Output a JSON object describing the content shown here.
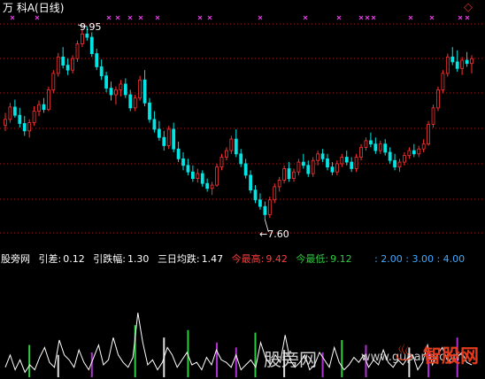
{
  "header": {
    "symbol": "万 科A(日线)",
    "nav_icon": "diamond-icon"
  },
  "chart_data": {
    "type": "candlestick",
    "title": "",
    "high_annotation": "9.95",
    "low_annotation": "←7.60",
    "price_high": 9.95,
    "price_low": 7.6,
    "ohlc": [
      [
        8.75,
        8.9,
        8.68,
        8.82
      ],
      [
        8.82,
        9.02,
        8.78,
        8.97
      ],
      [
        8.97,
        9.06,
        8.84,
        8.87
      ],
      [
        8.87,
        8.96,
        8.72,
        8.77
      ],
      [
        8.77,
        8.86,
        8.62,
        8.68
      ],
      [
        8.68,
        8.82,
        8.6,
        8.78
      ],
      [
        8.78,
        8.98,
        8.74,
        8.92
      ],
      [
        8.92,
        9.05,
        8.86,
        9.0
      ],
      [
        9.0,
        9.08,
        8.9,
        8.94
      ],
      [
        8.94,
        9.22,
        8.92,
        9.18
      ],
      [
        9.18,
        9.42,
        9.14,
        9.38
      ],
      [
        9.38,
        9.63,
        9.34,
        9.58
      ],
      [
        9.58,
        9.7,
        9.44,
        9.48
      ],
      [
        9.48,
        9.56,
        9.36,
        9.42
      ],
      [
        9.42,
        9.6,
        9.38,
        9.56
      ],
      [
        9.56,
        9.78,
        9.52,
        9.74
      ],
      [
        9.74,
        9.92,
        9.7,
        9.86
      ],
      [
        9.86,
        9.95,
        9.78,
        9.82
      ],
      [
        9.82,
        9.88,
        9.58,
        9.62
      ],
      [
        9.62,
        9.68,
        9.42,
        9.46
      ],
      [
        9.46,
        9.55,
        9.3,
        9.35
      ],
      [
        9.35,
        9.4,
        9.15,
        9.2
      ],
      [
        9.2,
        9.28,
        9.05,
        9.12
      ],
      [
        9.12,
        9.22,
        9.0,
        9.18
      ],
      [
        9.18,
        9.3,
        9.1,
        9.25
      ],
      [
        9.25,
        9.32,
        9.08,
        9.12
      ],
      [
        9.12,
        9.18,
        8.92,
        8.96
      ],
      [
        8.96,
        9.12,
        8.92,
        9.08
      ],
      [
        9.08,
        9.35,
        9.05,
        9.3
      ],
      [
        9.3,
        9.42,
        8.98,
        9.02
      ],
      [
        9.02,
        9.08,
        8.78,
        8.82
      ],
      [
        8.82,
        8.92,
        8.66,
        8.7
      ],
      [
        8.7,
        8.8,
        8.56,
        8.6
      ],
      [
        8.6,
        8.68,
        8.44,
        8.5
      ],
      [
        8.5,
        8.74,
        8.46,
        8.7
      ],
      [
        8.7,
        8.78,
        8.42,
        8.46
      ],
      [
        8.46,
        8.55,
        8.3,
        8.34
      ],
      [
        8.34,
        8.42,
        8.2,
        8.26
      ],
      [
        8.26,
        8.34,
        8.14,
        8.18
      ],
      [
        8.18,
        8.26,
        8.06,
        8.1
      ],
      [
        8.1,
        8.22,
        8.05,
        8.16
      ],
      [
        8.16,
        8.2,
        8.0,
        8.04
      ],
      [
        8.04,
        8.1,
        7.94,
        7.98
      ],
      [
        7.98,
        8.06,
        7.9,
        8.02
      ],
      [
        8.02,
        8.28,
        8.0,
        8.24
      ],
      [
        8.24,
        8.4,
        8.2,
        8.36
      ],
      [
        8.36,
        8.48,
        8.32,
        8.44
      ],
      [
        8.44,
        8.62,
        8.4,
        8.58
      ],
      [
        8.58,
        8.7,
        8.36,
        8.4
      ],
      [
        8.4,
        8.46,
        8.24,
        8.28
      ],
      [
        8.28,
        8.34,
        8.1,
        8.14
      ],
      [
        8.14,
        8.2,
        7.92,
        7.96
      ],
      [
        7.96,
        8.02,
        7.8,
        7.84
      ],
      [
        7.84,
        7.92,
        7.72,
        7.76
      ],
      [
        7.76,
        7.82,
        7.6,
        7.66
      ],
      [
        7.66,
        7.88,
        7.62,
        7.84
      ],
      [
        7.84,
        8.04,
        7.8,
        8.0
      ],
      [
        8.0,
        8.12,
        7.94,
        8.08
      ],
      [
        8.08,
        8.26,
        8.04,
        8.22
      ],
      [
        8.22,
        8.3,
        8.06,
        8.1
      ],
      [
        8.1,
        8.22,
        8.06,
        8.18
      ],
      [
        8.18,
        8.34,
        8.14,
        8.3
      ],
      [
        8.3,
        8.4,
        8.22,
        8.26
      ],
      [
        8.26,
        8.32,
        8.12,
        8.16
      ],
      [
        8.16,
        8.36,
        8.12,
        8.32
      ],
      [
        8.32,
        8.44,
        8.26,
        8.4
      ],
      [
        8.4,
        8.46,
        8.3,
        8.34
      ],
      [
        8.34,
        8.4,
        8.2,
        8.24
      ],
      [
        8.24,
        8.3,
        8.14,
        8.18
      ],
      [
        8.18,
        8.32,
        8.14,
        8.28
      ],
      [
        8.28,
        8.4,
        8.24,
        8.36
      ],
      [
        8.36,
        8.44,
        8.26,
        8.3
      ],
      [
        8.3,
        8.36,
        8.18,
        8.22
      ],
      [
        8.22,
        8.4,
        8.18,
        8.36
      ],
      [
        8.36,
        8.52,
        8.32,
        8.48
      ],
      [
        8.48,
        8.6,
        8.44,
        8.56
      ],
      [
        8.56,
        8.66,
        8.48,
        8.52
      ],
      [
        8.52,
        8.6,
        8.4,
        8.44
      ],
      [
        8.44,
        8.56,
        8.4,
        8.52
      ],
      [
        8.52,
        8.58,
        8.38,
        8.42
      ],
      [
        8.42,
        8.48,
        8.28,
        8.32
      ],
      [
        8.32,
        8.4,
        8.2,
        8.24
      ],
      [
        8.24,
        8.34,
        8.18,
        8.3
      ],
      [
        8.3,
        8.42,
        8.26,
        8.38
      ],
      [
        8.38,
        8.48,
        8.34,
        8.44
      ],
      [
        8.44,
        8.52,
        8.36,
        8.4
      ],
      [
        8.4,
        8.5,
        8.36,
        8.46
      ],
      [
        8.46,
        8.58,
        8.42,
        8.52
      ],
      [
        8.52,
        8.8,
        8.5,
        8.76
      ],
      [
        8.76,
        9.0,
        8.72,
        8.96
      ],
      [
        8.96,
        9.22,
        8.92,
        9.18
      ],
      [
        9.18,
        9.42,
        9.14,
        9.38
      ],
      [
        9.38,
        9.62,
        9.34,
        9.58
      ],
      [
        9.58,
        9.7,
        9.48,
        9.52
      ],
      [
        9.52,
        9.66,
        9.4,
        9.44
      ],
      [
        9.44,
        9.58,
        9.36,
        9.54
      ],
      [
        9.54,
        9.64,
        9.46,
        9.5
      ],
      [
        9.5,
        9.6,
        9.38,
        9.56
      ]
    ],
    "sub_values": [
      0.4,
      0.9,
      0.3,
      0.7,
      0.2,
      0.5,
      0.3,
      0.8,
      1.2,
      0.6,
      0.4,
      1.5,
      0.9,
      0.7,
      0.4,
      1.1,
      0.6,
      0.3,
      0.8,
      1.3,
      0.5,
      0.7,
      1.6,
      0.9,
      0.6,
      0.4,
      0.8,
      2.6,
      1.4,
      0.5,
      0.7,
      0.3,
      0.6,
      1.2,
      0.9,
      0.4,
      0.7,
      1.0,
      0.5,
      0.6,
      0.3,
      0.8,
      0.5,
      1.1,
      0.7,
      0.6,
      0.4,
      0.9,
      0.3,
      0.5,
      0.7,
      0.4,
      1.4,
      0.8,
      0.5,
      0.9,
      0.6,
      1.7,
      0.7,
      0.4,
      0.6,
      0.9,
      0.3,
      0.5,
      1.0,
      0.7,
      0.4,
      1.2,
      0.6,
      0.3,
      0.5,
      0.8,
      0.6,
      0.9,
      0.4,
      0.7,
      0.5,
      1.1,
      0.6,
      0.4,
      0.7,
      0.5,
      0.8,
      0.9,
      0.3,
      0.6,
      1.3,
      0.5,
      0.9,
      1.2,
      0.7,
      0.6,
      0.8,
      1.0,
      0.6,
      0.5
    ],
    "ratio_bars": [
      [
        5,
        1.3,
        "green"
      ],
      [
        11,
        0.9,
        "white"
      ],
      [
        18,
        1.0,
        "purple"
      ],
      [
        27,
        2.1,
        "green"
      ],
      [
        33,
        1.6,
        "white"
      ],
      [
        38,
        1.9,
        "green"
      ],
      [
        44,
        1.4,
        "purple"
      ],
      [
        48,
        1.2,
        "purple"
      ],
      [
        52,
        1.8,
        "green"
      ],
      [
        58,
        1.1,
        "white"
      ],
      [
        66,
        1.0,
        "purple"
      ],
      [
        70,
        1.5,
        "green"
      ],
      [
        75,
        1.3,
        "purple"
      ],
      [
        84,
        1.2,
        "white"
      ],
      [
        88,
        1.0,
        "purple"
      ],
      [
        94,
        1.6,
        "purple"
      ]
    ]
  },
  "indicator_bar": {
    "source": "股旁网",
    "yincha_label": "引差:",
    "yincha_value": "0.12",
    "yindiefu_label": "引跌幅:",
    "yindiefu_value": "1.30",
    "sanri_label": "三日均跌:",
    "sanri_value": "1.47",
    "max_label": "今最高:",
    "max_value": "9.42",
    "min_label": "今最低:",
    "min_value": "9.12",
    "levels": ": 2.00 : 3.00 : 4.00"
  },
  "watermarks": {
    "left": "股旁网",
    "url": "www.gupang.com",
    "brand": "智股网"
  },
  "colors": {
    "up": "#ff3333",
    "down": "#00e5e5",
    "grid": "#b01a1a",
    "marker": "#e040e0",
    "sub_line": "#ffffff",
    "bar_green": "#2ecc40",
    "bar_purple": "#b030d0",
    "bar_white": "#dddddd"
  }
}
